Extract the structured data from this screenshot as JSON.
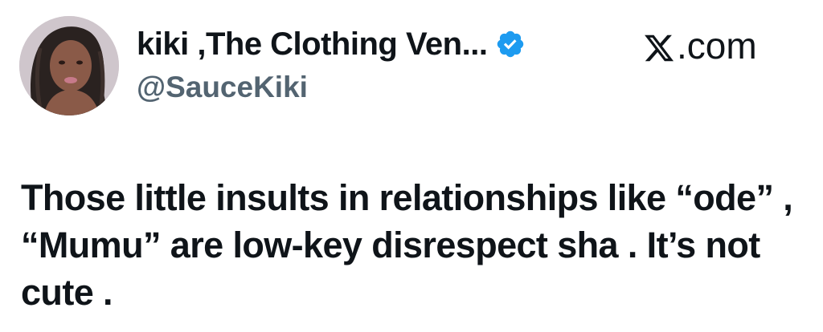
{
  "author": {
    "display_name": "kiki ,The Clothing Ven...",
    "handle": "@SauceKiki",
    "verified": true,
    "avatar": "profile-photo"
  },
  "brand": {
    "text": "com",
    "logo": "x-logo-icon"
  },
  "tweet": {
    "text": "Those little insults in relationships like “ode” , “Mumu” are low-key disrespect sha . It’s not cute ."
  },
  "colors": {
    "text_primary": "#0f1419",
    "text_secondary": "#536471",
    "verified_blue": "#1d9bf0",
    "background": "#ffffff"
  }
}
